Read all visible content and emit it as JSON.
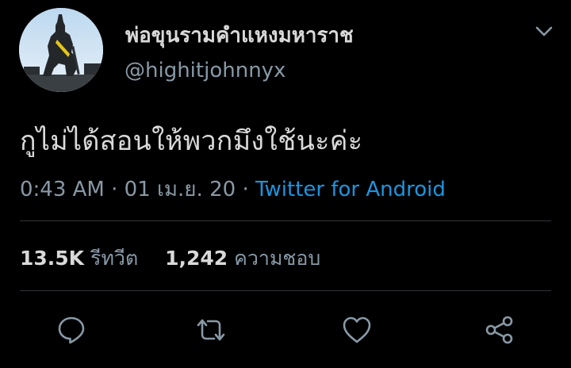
{
  "author": {
    "display_name": "พ่อขุนรามคำแหงมหาราช",
    "handle": "@highitjohnnyx"
  },
  "tweet": {
    "text": "กูไม่ได้สอนให้พวกมึงใช้นะค่ะ",
    "time": "0:43 AM",
    "separator": "·",
    "date": "01 เม.ย. 20",
    "source": "Twitter for Android"
  },
  "stats": {
    "retweets_count": "13.5K",
    "retweets_label": "รีทวีต",
    "likes_count": "1,242",
    "likes_label": "ความชอบ"
  },
  "icons": {
    "more": "chevron-down-icon",
    "reply": "reply-icon",
    "retweet": "retweet-icon",
    "like": "heart-icon",
    "share": "share-icon"
  },
  "colors": {
    "background": "#000000",
    "text_primary": "#d9d9d9",
    "text_secondary": "#8899a6",
    "link": "#1b95e0",
    "divider": "#2f3336"
  }
}
